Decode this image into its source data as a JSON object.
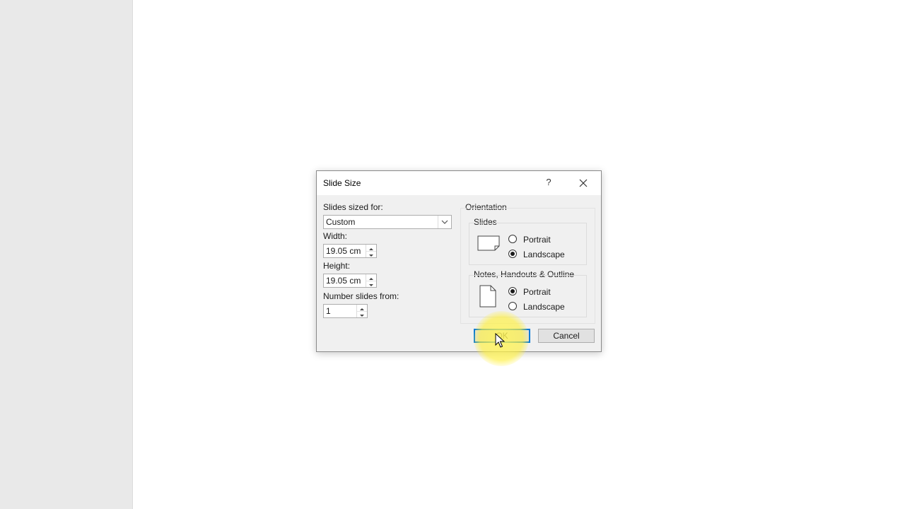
{
  "dialog": {
    "title": "Slide Size",
    "help_glyph": "?",
    "slides_sized_for_label": "Slides sized for:",
    "slides_sized_for_value": "Custom",
    "width_label": "Width:",
    "width_value": "19.05 cm",
    "height_label": "Height:",
    "height_value": "19.05 cm",
    "number_slides_label": "Number slides from:",
    "number_slides_value": "1",
    "orientation_label": "Orientation",
    "slides_section_label": "Slides",
    "slides_options": [
      {
        "label": "Portrait",
        "checked": false
      },
      {
        "label": "Landscape",
        "checked": true
      }
    ],
    "notes_section_label": "Notes, Handouts & Outline",
    "notes_options": [
      {
        "label": "Portrait",
        "checked": true
      },
      {
        "label": "Landscape",
        "checked": false
      }
    ],
    "ok_label": "OK",
    "cancel_label": "Cancel"
  },
  "colors": {
    "accent": "#0078d7",
    "left_pane": "#e9e9e9",
    "dialog_bg": "#f0f0f0",
    "cursor_highlight": "#fff15a"
  },
  "icons": [
    "help-icon",
    "close-icon",
    "chevron-down-icon",
    "spin-up-icon",
    "spin-down-icon",
    "landscape-slide-icon",
    "portrait-page-icon",
    "mouse-cursor-icon"
  ]
}
